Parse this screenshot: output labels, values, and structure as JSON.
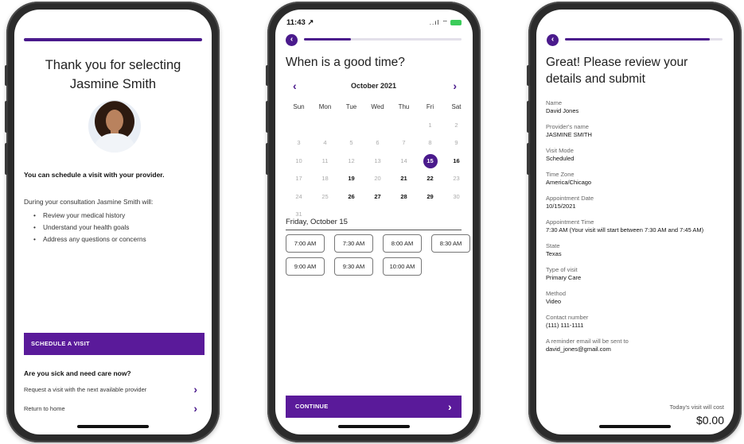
{
  "phone1": {
    "title_line1": "Thank you for selecting",
    "title_line2": "Jasmine Smith",
    "schedule_note": "You can schedule a visit with your provider.",
    "consult_intro": "During your consultation Jasmine Smith will:",
    "bullets": [
      "Review your medical history",
      "Understand your health goals",
      "Address any questions or concerns"
    ],
    "schedule_button": "SCHEDULE A VISIT",
    "sick_heading": "Are you sick and need care now?",
    "link_next_provider": "Request a visit with the next available provider",
    "link_home": "Return to home",
    "chevron": "›"
  },
  "phone2": {
    "status_time": "11:43",
    "status_arrow": "↗",
    "status_signal": "..ıl ⌔",
    "back_glyph": "‹",
    "progress": 0.3,
    "title": "When is a good time?",
    "month": "October 2021",
    "prev": "‹",
    "next": "›",
    "weekdays": [
      "Sun",
      "Mon",
      "Tue",
      "Wed",
      "Thu",
      "Fri",
      "Sat"
    ],
    "days": [
      [
        "",
        "",
        "",
        "",
        "",
        "1",
        "2"
      ],
      [
        "3",
        "4",
        "5",
        "6",
        "7",
        "8",
        "9"
      ],
      [
        "10",
        "11",
        "12",
        "13",
        "14",
        "15",
        "16"
      ],
      [
        "17",
        "18",
        "19",
        "20",
        "21",
        "22",
        "23"
      ],
      [
        "24",
        "25",
        "26",
        "27",
        "28",
        "29",
        "30"
      ],
      [
        "31",
        "",
        "",
        "",
        "",
        "",
        ""
      ]
    ],
    "available_days": [
      "16",
      "19",
      "21",
      "22",
      "26",
      "27",
      "28",
      "29"
    ],
    "selected_day": "15",
    "selected_label": "Friday, October 15",
    "slots": [
      "7:00 AM",
      "7:30 AM",
      "8:00 AM",
      "8:30 AM",
      "9:00 AM",
      "9:30 AM",
      "10:00 AM"
    ],
    "continue_button": "CONTINUE",
    "continue_chevron": "›"
  },
  "phone3": {
    "back_glyph": "‹",
    "progress": 0.92,
    "title": "Great! Please review your details and submit",
    "fields": [
      {
        "label": "Name",
        "value": "David Jones"
      },
      {
        "label": "Provider's name",
        "value": "JASMINE SMITH"
      },
      {
        "label": "Visit Mode",
        "value": "Scheduled"
      },
      {
        "label": "Time Zone",
        "value": "America/Chicago"
      },
      {
        "label": "Appointment Date",
        "value": "10/15/2021"
      },
      {
        "label": "Appointment Time",
        "value": "7:30 AM (Your visit will start between 7:30 AM and 7:45 AM)"
      },
      {
        "label": "State",
        "value": "Texas"
      },
      {
        "label": "Type of visit",
        "value": "Primary Care"
      },
      {
        "label": "Method",
        "value": "Video"
      },
      {
        "label": "Contact number",
        "value": "(111) 111-1111"
      },
      {
        "label": "A reminder email will be sent to",
        "value": "david_jones@gmail.com"
      }
    ],
    "cost_label": "Today's visit will cost",
    "cost_value": "$0.00"
  },
  "colors": {
    "brand_purple": "#5a1a9a",
    "accent_purple": "#4a1a8c"
  }
}
